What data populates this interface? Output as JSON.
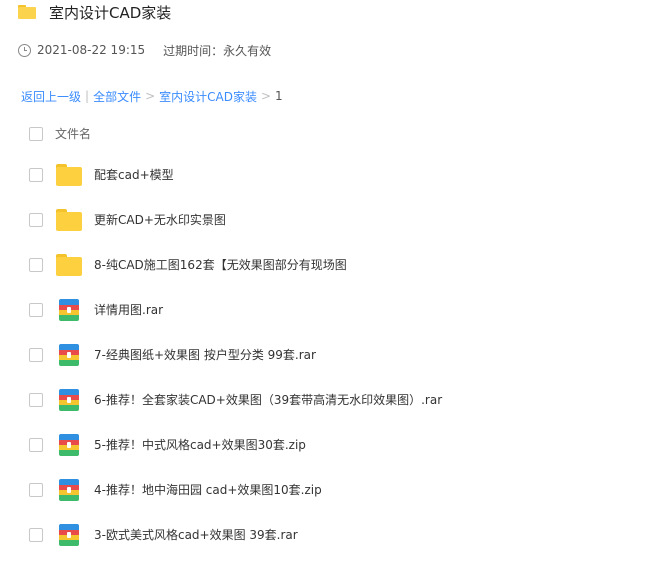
{
  "header": {
    "title": "室内设计CAD家装",
    "icon": "folder-icon"
  },
  "meta": {
    "date": "2021-08-22 19:15",
    "expire_label": "过期时间：永久有效"
  },
  "breadcrumb": {
    "back": "返回上一级",
    "sep1": "|",
    "all": "全部文件",
    "arrow1": ">",
    "folder": "室内设计CAD家装",
    "arrow2": ">",
    "current": "1"
  },
  "list": {
    "column_header": "文件名",
    "items": [
      {
        "name": "配套cad+模型",
        "type": "folder"
      },
      {
        "name": "更新CAD+无水印实景图",
        "type": "folder"
      },
      {
        "name": "8-纯CAD施工图162套【无效果图部分有现场图",
        "type": "folder"
      },
      {
        "name": "详情用图.rar",
        "type": "archive"
      },
      {
        "name": "7-经典图纸+效果图 按户型分类 99套.rar",
        "type": "archive"
      },
      {
        "name": "6-推荐！全套家装CAD+效果图（39套带高清无水印效果图）.rar",
        "type": "archive"
      },
      {
        "name": "5-推荐！中式风格cad+效果图30套.zip",
        "type": "archive"
      },
      {
        "name": "4-推荐！地中海田园 cad+效果图10套.zip",
        "type": "archive"
      },
      {
        "name": "3-欧式美式风格cad+效果图 39套.rar",
        "type": "archive"
      }
    ]
  },
  "colors": {
    "link": "#3b8cff",
    "folder": "#fcd03f"
  }
}
